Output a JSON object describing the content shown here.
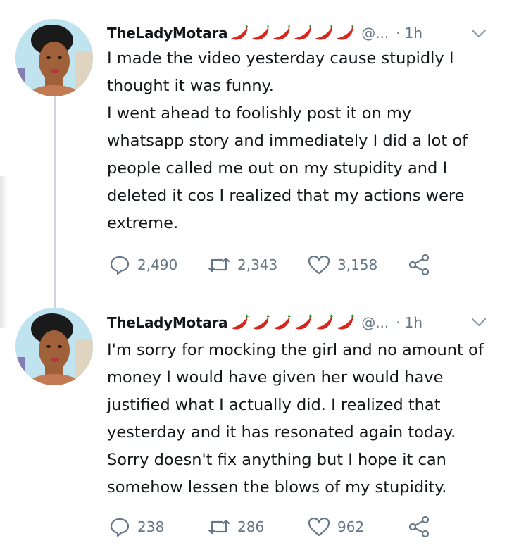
{
  "tweets": [
    {
      "author_name": "TheLadyMotara",
      "emoji_count": 6,
      "emoji": "hot-pepper",
      "handle": "@...",
      "separator": "·",
      "time": "1h",
      "text_lines": [
        "I made the video yesterday cause stupidly I",
        "thought it was funny.",
        "I went ahead to foolishly post it on my",
        "whatsapp story and immediately I did a lot of",
        "people called me out on my stupidity and I",
        "deleted it cos I realized that my actions were",
        "extreme."
      ],
      "replies": "2,490",
      "retweets": "2,343",
      "likes": "3,158"
    },
    {
      "author_name": "TheLadyMotara",
      "emoji_count": 6,
      "emoji": "hot-pepper",
      "handle": "@...",
      "separator": "·",
      "time": "1h",
      "text_lines": [
        "I'm sorry for mocking the girl and no amount of",
        "money I would have given her would have",
        "justified what I actually did. I realized that",
        "yesterday and it has resonated again today.",
        "Sorry doesn't fix anything but I hope it can",
        "somehow lessen the blows of my stupidity."
      ],
      "replies": "238",
      "retweets": "286",
      "likes": "962"
    }
  ],
  "colors": {
    "text": "#14171a",
    "muted": "#657786",
    "thread_line": "#cdd5dc",
    "chili": "#d7261e"
  },
  "icons": [
    "reply-icon",
    "retweet-icon",
    "like-icon",
    "share-icon",
    "chevron-down-icon",
    "hot-pepper-emoji"
  ]
}
